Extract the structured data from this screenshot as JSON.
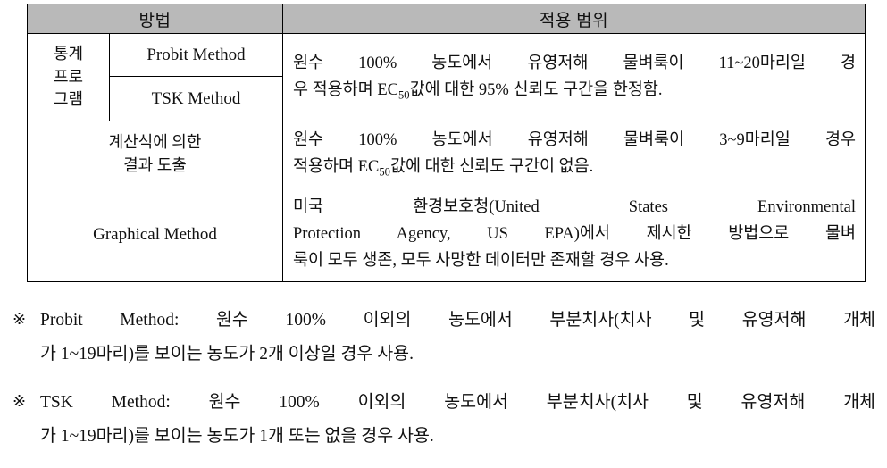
{
  "table": {
    "headers": {
      "method": "방법",
      "scope": "적용 범위"
    },
    "rows": [
      {
        "group_label": "통계\n프로\n그램",
        "group_lines": [
          "통계",
          "프로",
          "그램"
        ],
        "method": "Probit Method",
        "scope_line1": "원수 100% 농도에서 유영저해 물벼룩이 11~20마리일 경",
        "scope_line2_a": "우 적용하며 EC",
        "scope_line2_sub": "50",
        "scope_line2_b": "값에 대한 95% 신뢰도 구간을 한정함."
      },
      {
        "method": "TSK Method"
      },
      {
        "method_lines": [
          "계산식에 의한",
          "결과 도출"
        ],
        "scope_line1": "원수 100% 농도에서 유영저해 물벼룩이 3~9마리일 경우",
        "scope_line2_a": "적용하며 EC",
        "scope_line2_sub": "50",
        "scope_line2_b": "값에 대한 신뢰도 구간이 없음."
      },
      {
        "method": "Graphical Method",
        "scope_line1": "미국 환경보호청(United States Environmental",
        "scope_line2": "Protection Agency, US EPA)에서 제시한 방법으로 물벼",
        "scope_line3": "룩이 모두 생존, 모두 사망한 데이터만 존재할 경우 사용."
      }
    ]
  },
  "notes": [
    {
      "mark": "※",
      "line1": "Probit Method: 원수 100% 이외의 농도에서 부분치사(치사 및 유영저해 개체",
      "line2": "가 1~19마리)를 보이는 농도가 2개 이상일 경우 사용."
    },
    {
      "mark": "※",
      "line1": "TSK Method: 원수 100% 이외의 농도에서 부분치사(치사 및 유영저해 개체",
      "line2": "가 1~19마리)를 보이는 농도가 1개 또는 없을 경우 사용."
    }
  ]
}
